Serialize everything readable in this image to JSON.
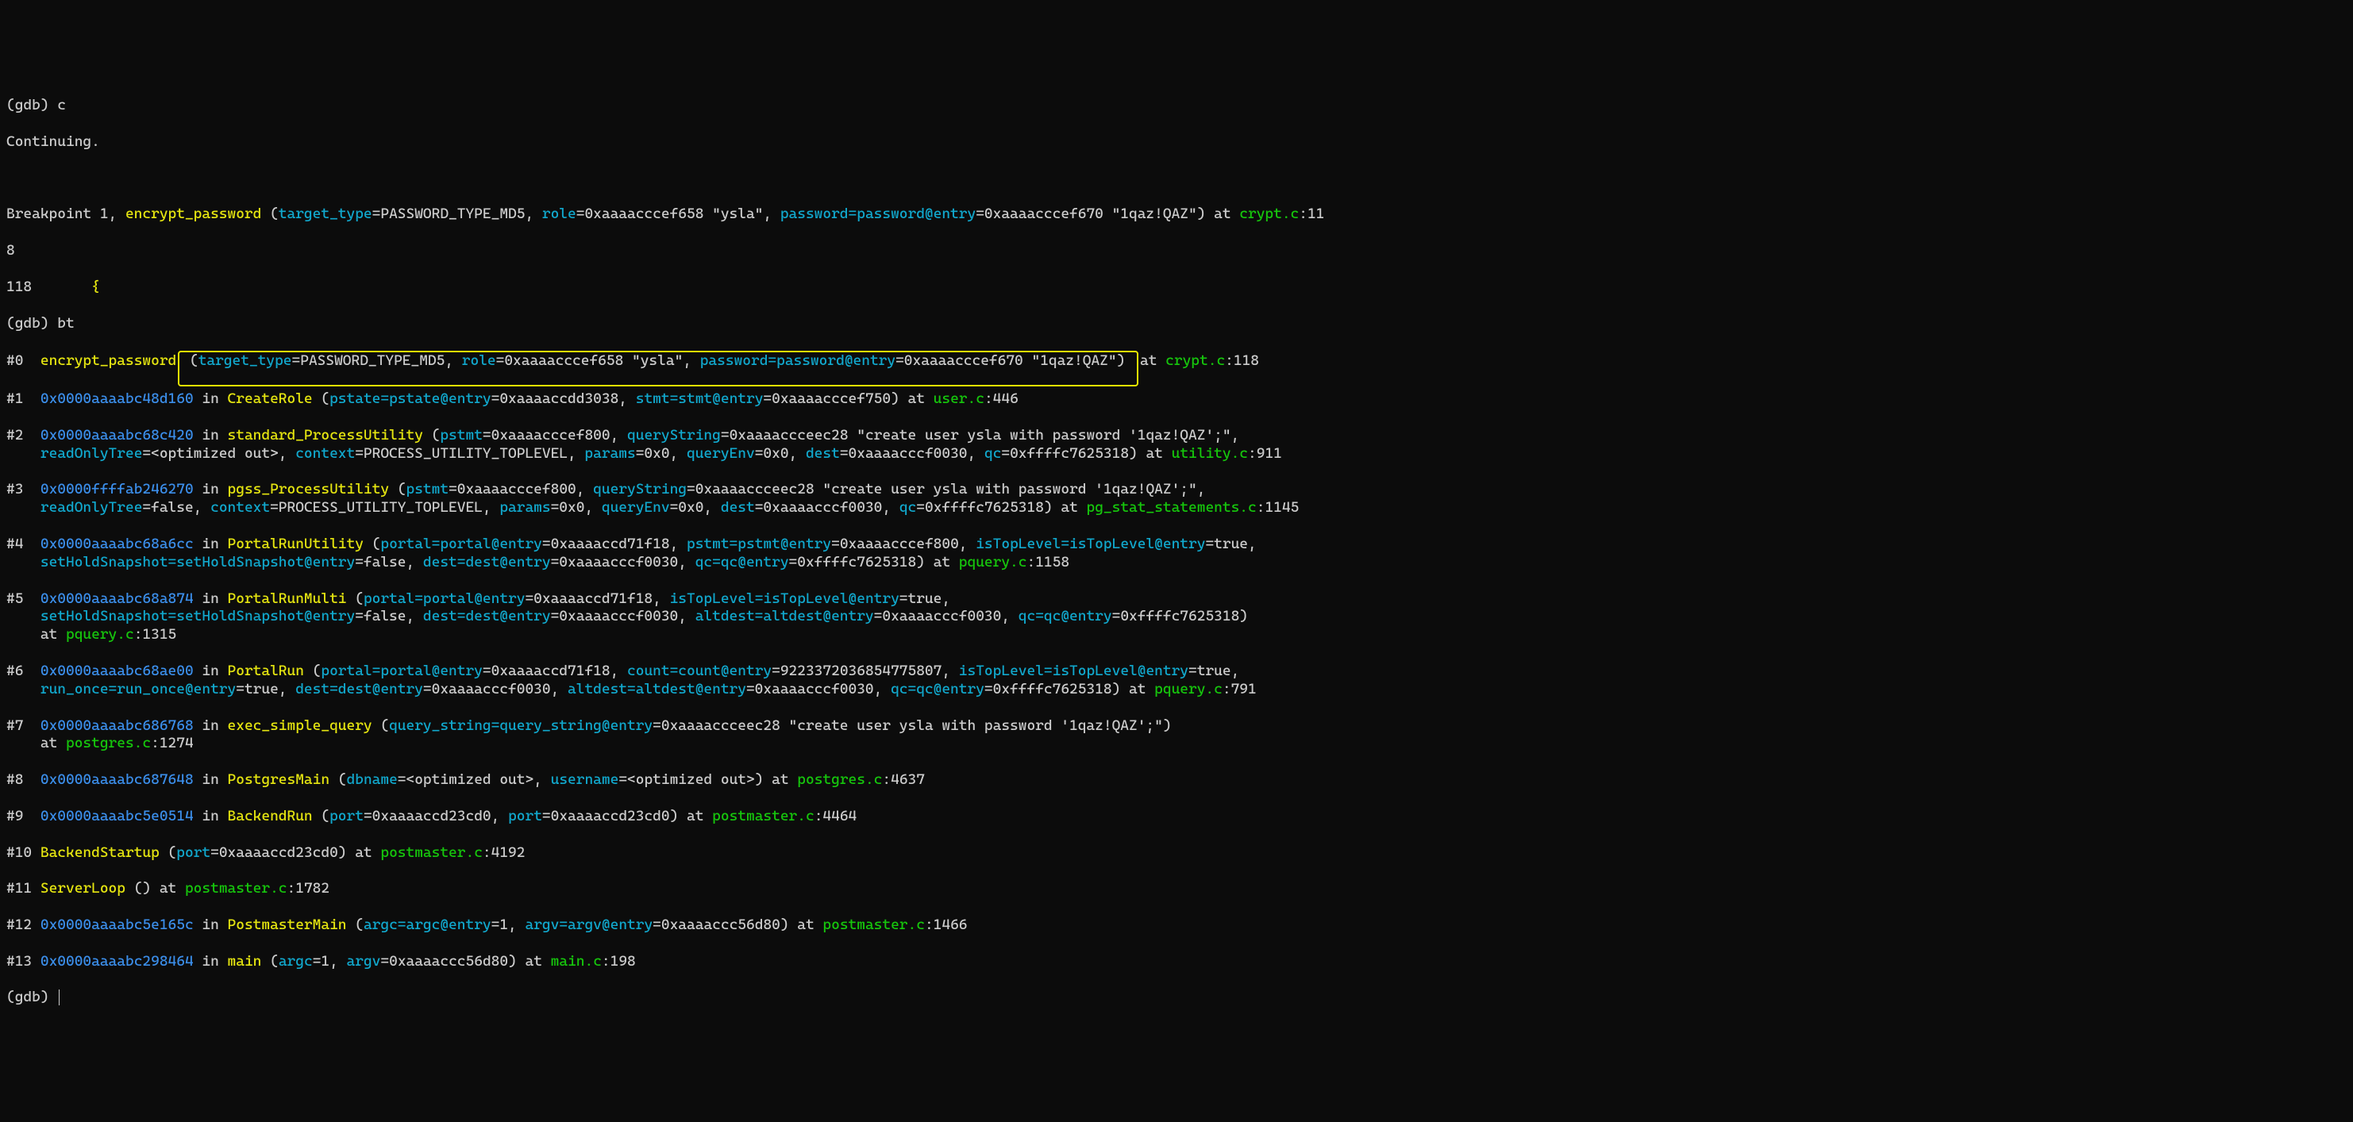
{
  "l0_prompt": "(gdb) ",
  "l0_cmd": "c",
  "l1": "Continuing.",
  "l_blank": " ",
  "l2a": "Breakpoint 1, ",
  "l2b": "encrypt_password",
  "l2c": " (",
  "l2d": "target_type",
  "l2e": "=PASSWORD_TYPE_MD5, ",
  "l2f": "role",
  "l2g": "=0xaaaacccef658 \"ysla\", ",
  "l2h": "password=password@entry",
  "l2i": "=0xaaaacccef670 \"1qaz!QAZ\") at ",
  "l2j": "crypt.c",
  "l2k": ":11",
  "l3": "8",
  "l4a": "118       ",
  "l4b": "{",
  "l5_prompt": "(gdb) ",
  "l5_cmd": "bt",
  "f0_a": "#0  ",
  "f0_b": "encrypt_password",
  "f0_c": " (",
  "f0_d": "target_type",
  "f0_e": "=PASSWORD_TYPE_MD5, ",
  "f0_f": "role",
  "f0_g": "=0xaaaacccef658 \"ysla\", ",
  "f0_h": "password=password@entry",
  "f0_i": "=0xaaaacccef670 \"1qaz!QAZ\") ",
  "f0_j": "at ",
  "f0_k": "crypt.c",
  "f0_l": ":118",
  "f1_a": "#1  ",
  "f1_b": "0x0000aaaabc48d160",
  "f1_c": " in ",
  "f1_d": "CreateRole",
  "f1_e": " (",
  "f1_f": "pstate=pstate@entry",
  "f1_g": "=0xaaaaccdd3038, ",
  "f1_h": "stmt=stmt@entry",
  "f1_i": "=0xaaaacccef750) at ",
  "f1_j": "user.c",
  "f1_k": ":446",
  "f2_a": "#2  ",
  "f2_b": "0x0000aaaabc68c420",
  "f2_c": " in ",
  "f2_d": "standard_ProcessUtility",
  "f2_e": " (",
  "f2_f": "pstmt",
  "f2_g": "=0xaaaacccef800, ",
  "f2_h": "queryString",
  "f2_i": "=0xaaaaccceec28 \"create user ysla with password '1qaz!QAZ';\", ",
  "f2_j": "readOnlyTree",
  "f2_k": "=<optimized out>, ",
  "f2_l": "context",
  "f2_m": "=PROCESS_UTILITY_TOPLEVEL, ",
  "f2_n": "params",
  "f2_o": "=0x0, ",
  "f2_p": "queryEnv",
  "f2_q": "=0x0, ",
  "f2_r": "dest",
  "f2_s": "=0xaaaacccf0030, ",
  "f2_t": "qc",
  "f2_u": "=0xffffc7625318) at ",
  "f2_v": "utility.c",
  "f2_w": ":911",
  "f3_a": "#3  ",
  "f3_b": "0x0000ffffab246270",
  "f3_c": " in ",
  "f3_d": "pgss_ProcessUtility",
  "f3_e": " (",
  "f3_f": "pstmt",
  "f3_g": "=0xaaaacccef800, ",
  "f3_h": "queryString",
  "f3_i": "=0xaaaaccceec28 \"create user ysla with password '1qaz!QAZ';\", ",
  "f3_j": "readOnlyTree",
  "f3_k": "=false, ",
  "f3_l": "context",
  "f3_m": "=PROCESS_UTILITY_TOPLEVEL, ",
  "f3_n": "params",
  "f3_o": "=0x0, ",
  "f3_p": "queryEnv",
  "f3_q": "=0x0, ",
  "f3_r": "dest",
  "f3_s": "=0xaaaacccf0030, ",
  "f3_t": "qc",
  "f3_u": "=0xffffc7625318) at ",
  "f3_v": "pg_stat_statements.c",
  "f3_w": ":1145",
  "f4_a": "#4  ",
  "f4_b": "0x0000aaaabc68a6cc",
  "f4_c": " in ",
  "f4_d": "PortalRunUtility",
  "f4_e": " (",
  "f4_f": "portal=portal@entry",
  "f4_g": "=0xaaaaccd71f18, ",
  "f4_h": "pstmt=pstmt@entry",
  "f4_i": "=0xaaaacccef800, ",
  "f4_j": "isTopLevel=isTopLevel@entry",
  "f4_k": "=true, ",
  "f4_l": "setHoldSnapshot=setHoldSnapshot@entry",
  "f4_m": "=false, ",
  "f4_n": "dest=dest@entry",
  "f4_o": "=0xaaaacccf0030, ",
  "f4_p": "qc=qc@entry",
  "f4_q": "=0xffffc7625318) at ",
  "f4_r": "pquery.c",
  "f4_s": ":1158",
  "f5_a": "#5  ",
  "f5_b": "0x0000aaaabc68a874",
  "f5_c": " in ",
  "f5_d": "PortalRunMulti",
  "f5_e": " (",
  "f5_f": "portal=portal@entry",
  "f5_g": "=0xaaaaccd71f18, ",
  "f5_h": "isTopLevel=isTopLevel@entry",
  "f5_i": "=true, ",
  "f5_j": "setHoldSnapshot=setHoldSnapshot@entry",
  "f5_k": "=false, ",
  "f5_l": "dest=dest@entry",
  "f5_m": "=0xaaaacccf0030, ",
  "f5_n": "altdest=altdest@entry",
  "f5_o": "=0xaaaacccf0030, ",
  "f5_p": "qc=qc@entry",
  "f5_q": "=0xffffc7625318)",
  "f5_r": "    at ",
  "f5_s": "pquery.c",
  "f5_t": ":1315",
  "f6_a": "#6  ",
  "f6_b": "0x0000aaaabc68ae00",
  "f6_c": " in ",
  "f6_d": "PortalRun",
  "f6_e": " (",
  "f6_f": "portal=portal@entry",
  "f6_g": "=0xaaaaccd71f18, ",
  "f6_h": "count=count@entry",
  "f6_i": "=9223372036854775807, ",
  "f6_j": "isTopLevel=isTopLevel@entry",
  "f6_k": "=true, ",
  "f6_l": "run_once=run_once@entry",
  "f6_m": "=true, ",
  "f6_n": "dest=dest@entry",
  "f6_o": "=0xaaaacccf0030, ",
  "f6_p": "altdest=altdest@entry",
  "f6_q": "=0xaaaacccf0030, ",
  "f6_r": "qc=qc@entry",
  "f6_s": "=0xffffc7625318) at ",
  "f6_t": "pquery.c",
  "f6_u": ":791",
  "f7_a": "#7  ",
  "f7_b": "0x0000aaaabc686768",
  "f7_c": " in ",
  "f7_d": "exec_simple_query",
  "f7_e": " (",
  "f7_f": "query_string=query_string@entry",
  "f7_g": "=0xaaaaccceec28 \"create user ysla with password '1qaz!QAZ';\")",
  "f7_h": "    at ",
  "f7_i": "postgres.c",
  "f7_j": ":1274",
  "f8_a": "#8  ",
  "f8_b": "0x0000aaaabc687648",
  "f8_c": " in ",
  "f8_d": "PostgresMain",
  "f8_e": " (",
  "f8_f": "dbname",
  "f8_g": "=<optimized out>, ",
  "f8_h": "username",
  "f8_i": "=<optimized out>) at ",
  "f8_j": "postgres.c",
  "f8_k": ":4637",
  "f9_a": "#9  ",
  "f9_b": "0x0000aaaabc5e0514",
  "f9_c": " in ",
  "f9_d": "BackendRun",
  "f9_e": " (",
  "f9_f": "port",
  "f9_g": "=0xaaaaccd23cd0, ",
  "f9_h": "port",
  "f9_i": "=0xaaaaccd23cd0) at ",
  "f9_j": "postmaster.c",
  "f9_k": ":4464",
  "f10_a": "#10 ",
  "f10_b": "BackendStartup",
  "f10_c": " (",
  "f10_d": "port",
  "f10_e": "=0xaaaaccd23cd0) at ",
  "f10_f": "postmaster.c",
  "f10_g": ":4192",
  "f11_a": "#11 ",
  "f11_b": "ServerLoop",
  "f11_c": " () at ",
  "f11_d": "postmaster.c",
  "f11_e": ":1782",
  "f12_a": "#12 ",
  "f12_b": "0x0000aaaabc5e165c",
  "f12_c": " in ",
  "f12_d": "PostmasterMain",
  "f12_e": " (",
  "f12_f": "argc=argc@entry",
  "f12_g": "=1, ",
  "f12_h": "argv=argv@entry",
  "f12_i": "=0xaaaaccc56d80) at ",
  "f12_j": "postmaster.c",
  "f12_k": ":1466",
  "f13_a": "#13 ",
  "f13_b": "0x0000aaaabc298464",
  "f13_c": " in ",
  "f13_d": "main",
  "f13_e": " (",
  "f13_f": "argc",
  "f13_g": "=1, ",
  "f13_h": "argv",
  "f13_i": "=0xaaaaccc56d80) at ",
  "f13_j": "main.c",
  "f13_k": ":198",
  "lend": "(gdb) "
}
